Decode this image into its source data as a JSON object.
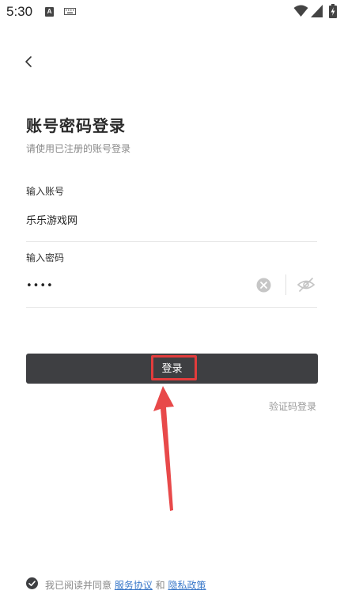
{
  "status_bar": {
    "time": "5:30",
    "icons": [
      "a-icon",
      "keyboard-icon",
      "wifi-icon",
      "signal-icon",
      "battery-charging-icon"
    ]
  },
  "header": {
    "back_icon": "chevron-left-icon"
  },
  "form": {
    "title": "账号密码登录",
    "subtitle": "请使用已注册的账号登录",
    "account": {
      "label": "输入账号",
      "value": "乐乐游戏网"
    },
    "password": {
      "label": "输入密码",
      "value": "••••",
      "clear_icon": "clear-icon",
      "visibility_icon": "eye-off-icon"
    },
    "login_button_label": "登录",
    "sms_login_label": "验证码登录"
  },
  "agreement": {
    "checked": true,
    "prefix": "我已阅读并同意 ",
    "terms_label": "服务协议",
    "joiner": " 和 ",
    "privacy_label": "隐私政策"
  },
  "colors": {
    "button_bg": "#3e3f42",
    "highlight": "#e33c3c",
    "link": "#3a78c9"
  }
}
